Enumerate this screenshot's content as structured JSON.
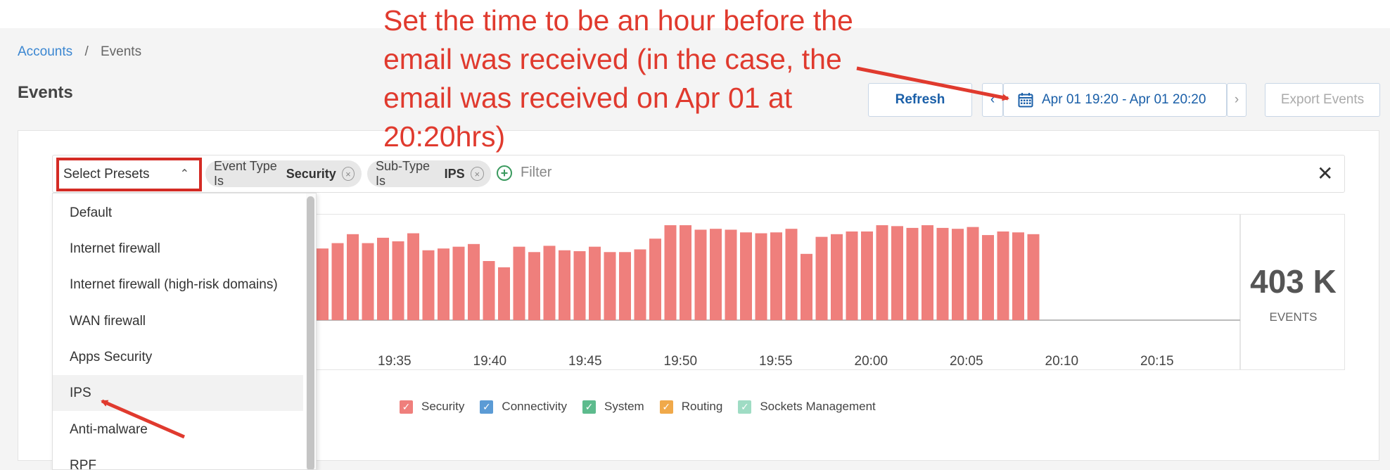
{
  "breadcrumb": {
    "items": [
      "Accounts",
      "Events"
    ],
    "separator": "/"
  },
  "page": {
    "title": "Events"
  },
  "toolbar": {
    "refresh_label": "Refresh",
    "prev_label": "‹",
    "range_label": "Apr 01 19:20 - Apr 01 20:20",
    "next_label": "›",
    "export_label": "Export Events"
  },
  "filters": {
    "preset_label": "Select Presets",
    "preset_chevron": "⌃",
    "chips": [
      {
        "prefix": "Event Type Is",
        "value": "Security"
      },
      {
        "prefix": "Sub-Type Is",
        "value": "IPS"
      }
    ],
    "chip_remove_glyph": "×",
    "add_plus": "+",
    "add_label": "Filter",
    "clear_glyph": "✕"
  },
  "presets_dropdown": {
    "items": [
      "Default",
      "Internet firewall",
      "Internet firewall (high-risk domains)",
      "WAN firewall",
      "Apps Security",
      "IPS",
      "Anti-malware",
      "RPF"
    ],
    "highlighted": "IPS"
  },
  "summary": {
    "value": "403 K",
    "label": "EVENTS"
  },
  "chart_data": {
    "type": "bar",
    "x_tick_labels": [
      "19:35",
      "19:40",
      "19:45",
      "19:50",
      "19:55",
      "20:00",
      "20:05",
      "20:10",
      "20:15"
    ],
    "series": [
      {
        "name": "Security",
        "color": "#ef7f7c",
        "values": [
          80,
          86,
          96,
          86,
          92,
          88,
          97,
          78,
          80,
          82,
          85,
          66,
          59,
          82,
          76,
          83,
          78,
          77,
          82,
          76,
          76,
          79,
          91,
          106,
          106,
          101,
          102,
          101,
          98,
          97,
          98,
          102,
          74,
          93,
          96,
          99,
          99,
          106,
          105,
          103,
          106,
          103,
          102,
          104,
          95,
          99,
          98,
          96
        ]
      }
    ],
    "legend": [
      {
        "name": "Security",
        "color": "#ef7f7c",
        "checked": true
      },
      {
        "name": "Connectivity",
        "color": "#5b9bd5",
        "checked": true
      },
      {
        "name": "System",
        "color": "#5dbb8d",
        "checked": true
      },
      {
        "name": "Routing",
        "color": "#f0a94a",
        "checked": true
      },
      {
        "name": "Sockets Management",
        "color": "#9fdcc4",
        "checked": true
      }
    ],
    "legend_check_glyph": "✓",
    "legend_position": "bottom"
  },
  "annotation": {
    "text": "Set the time to be an hour before the email was received (in the case, the email was received on Apr 01 at 20:20hrs)",
    "color": "#e03a2e"
  }
}
